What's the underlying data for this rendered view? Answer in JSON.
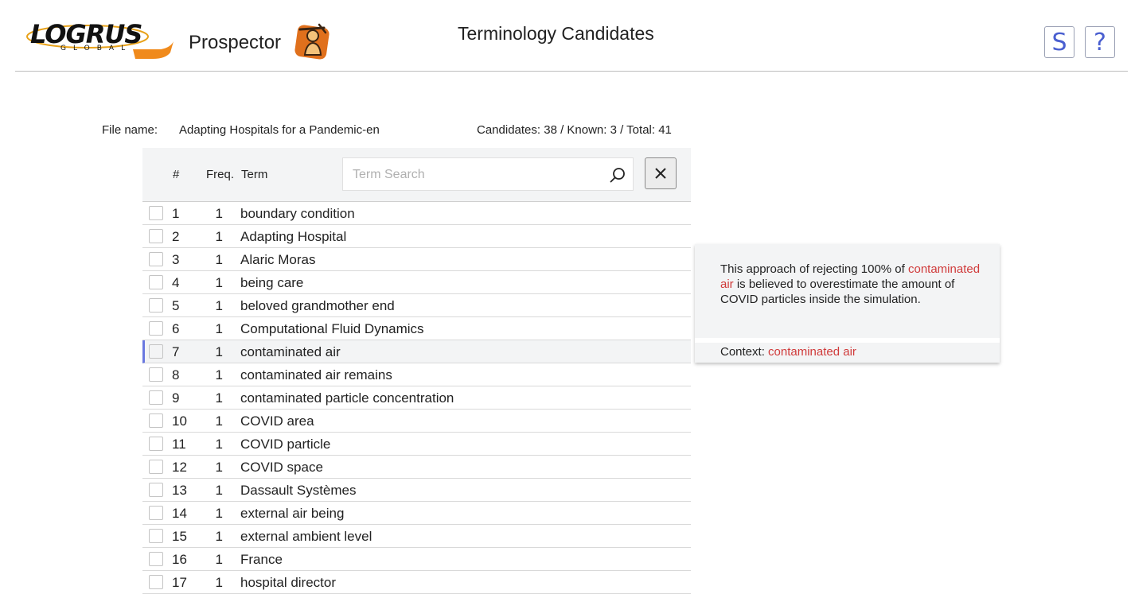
{
  "header": {
    "logo_text": "LOGRUS",
    "logo_sub": "GLOBAL",
    "app_name": "Prospector",
    "page_title": "Terminology Candidates",
    "settings_button": "S",
    "help_button": "?",
    "accent_color": "#4a5fd0"
  },
  "file": {
    "label": "File name:",
    "name": "Adapting Hospitals for a Pandemic-en",
    "counts": "Candidates: 38 / Known: 3 / Total: 41"
  },
  "table": {
    "columns": {
      "num": "#",
      "freq": "Freq.",
      "term": "Term"
    },
    "search_placeholder": "Term Search",
    "search_value": "",
    "rows": [
      {
        "num": "1",
        "freq": "1",
        "term": "boundary condition"
      },
      {
        "num": "2",
        "freq": "1",
        "term": "Adapting Hospital"
      },
      {
        "num": "3",
        "freq": "1",
        "term": "Alaric Moras"
      },
      {
        "num": "4",
        "freq": "1",
        "term": "being care"
      },
      {
        "num": "5",
        "freq": "1",
        "term": "beloved grandmother end"
      },
      {
        "num": "6",
        "freq": "1",
        "term": "Computational Fluid Dynamics"
      },
      {
        "num": "7",
        "freq": "1",
        "term": "contaminated air"
      },
      {
        "num": "8",
        "freq": "1",
        "term": "contaminated air remains"
      },
      {
        "num": "9",
        "freq": "1",
        "term": "contaminated particle concentration"
      },
      {
        "num": "10",
        "freq": "1",
        "term": "COVID area"
      },
      {
        "num": "11",
        "freq": "1",
        "term": "COVID particle"
      },
      {
        "num": "12",
        "freq": "1",
        "term": "COVID space"
      },
      {
        "num": "13",
        "freq": "1",
        "term": "Dassault Systèmes"
      },
      {
        "num": "14",
        "freq": "1",
        "term": "external air being"
      },
      {
        "num": "15",
        "freq": "1",
        "term": "external ambient level"
      },
      {
        "num": "16",
        "freq": "1",
        "term": "France"
      },
      {
        "num": "17",
        "freq": "1",
        "term": "hospital director"
      }
    ],
    "selected_row": "7"
  },
  "context": {
    "text_before": "This approach of rejecting 100% of ",
    "highlight": "contaminated air",
    "text_after": " is believed to overestimate the amount of COVID particles inside the simulation.",
    "footer_label": "Context: ",
    "footer_term": "contaminated air",
    "highlight_color": "#d03a3a"
  }
}
